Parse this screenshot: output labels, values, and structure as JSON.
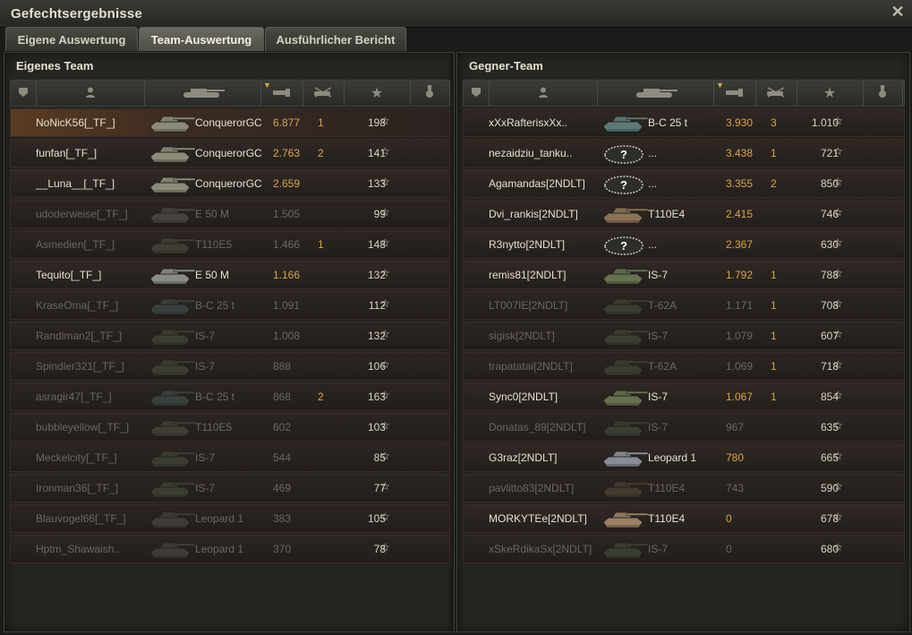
{
  "window": {
    "title": "Gefechtsergebnisse"
  },
  "tabs": [
    {
      "label": "Eigene Auswertung",
      "active": false
    },
    {
      "label": "Team-Auswertung",
      "active": true
    },
    {
      "label": "Ausführlicher Bericht",
      "active": false
    }
  ],
  "colors": {
    "damage": "#d7a64b",
    "accent_sort": "#d5a84a",
    "row_border": "#3a2a24"
  },
  "own_team": {
    "title": "Eigenes Team",
    "header_icons": [
      "platoon-icon",
      "player-icon",
      "tank-icon",
      "damage-icon",
      "kills-icon",
      "xp-star-icon",
      "medal-icon"
    ],
    "sorted_by": "damage-icon",
    "rows": [
      {
        "player": "NoNicK56[_TF_]",
        "tank": "ConquerorGC",
        "damage": "6.877",
        "kills": "1",
        "xp": "198",
        "alive": true,
        "top": true,
        "tank_color": "#8c8a78"
      },
      {
        "player": "funfan[_TF_]",
        "tank": "ConquerorGC",
        "damage": "2.763",
        "kills": "2",
        "xp": "141",
        "alive": true,
        "top": false,
        "tank_color": "#8c8a78"
      },
      {
        "player": "__Luna__[_TF_]",
        "tank": "ConquerorGC",
        "damage": "2.659",
        "kills": "",
        "xp": "133",
        "alive": true,
        "top": false,
        "tank_color": "#8c8a78"
      },
      {
        "player": "udoderweise[_TF_]",
        "tank": "E 50 M",
        "damage": "1.505",
        "kills": "",
        "xp": "99",
        "alive": false,
        "top": false,
        "tank_color": "#6b6e6a"
      },
      {
        "player": "Asmedien[_TF_]",
        "tank": "T110E5",
        "damage": "1.466",
        "kills": "1",
        "xp": "148",
        "alive": false,
        "top": false,
        "tank_color": "#5e6350"
      },
      {
        "player": "Tequito[_TF_]",
        "tank": "E 50 M",
        "damage": "1.166",
        "kills": "",
        "xp": "132",
        "alive": true,
        "top": false,
        "tank_color": "#8a8c86"
      },
      {
        "player": "KraseOma[_TF_]",
        "tank": "B-C 25 t",
        "damage": "1.091",
        "kills": "",
        "xp": "112",
        "alive": false,
        "top": false,
        "tank_color": "#4f6a68"
      },
      {
        "player": "Randlman2[_TF_]",
        "tank": "IS-7",
        "damage": "1.008",
        "kills": "",
        "xp": "132",
        "alive": false,
        "top": false,
        "tank_color": "#55624a"
      },
      {
        "player": "Spindler321[_TF_]",
        "tank": "IS-7",
        "damage": "888",
        "kills": "",
        "xp": "106",
        "alive": false,
        "top": false,
        "tank_color": "#55624a"
      },
      {
        "player": "asragir47[_TF_]",
        "tank": "B-C 25 t",
        "damage": "868",
        "kills": "2",
        "xp": "163",
        "alive": false,
        "top": false,
        "tank_color": "#4f6a68"
      },
      {
        "player": "bubbleyellow[_TF_]",
        "tank": "T110E5",
        "damage": "602",
        "kills": "",
        "xp": "103",
        "alive": false,
        "top": false,
        "tank_color": "#5e6350"
      },
      {
        "player": "Meckelcity[_TF_]",
        "tank": "IS-7",
        "damage": "544",
        "kills": "",
        "xp": "85",
        "alive": false,
        "top": false,
        "tank_color": "#55624a"
      },
      {
        "player": "Ironman36[_TF_]",
        "tank": "IS-7",
        "damage": "469",
        "kills": "",
        "xp": "77",
        "alive": false,
        "top": false,
        "tank_color": "#55624a"
      },
      {
        "player": "Blauvogel66[_TF_]",
        "tank": "Leopard 1",
        "damage": "383",
        "kills": "",
        "xp": "105",
        "alive": false,
        "top": false,
        "tank_color": "#5b5f58"
      },
      {
        "player": "Hptm_Shawaish..",
        "tank": "Leopard 1",
        "damage": "370",
        "kills": "",
        "xp": "78",
        "alive": false,
        "top": false,
        "tank_color": "#5b5f58"
      }
    ]
  },
  "enemy_team": {
    "title": "Gegner-Team",
    "header_icons": [
      "platoon-icon",
      "player-icon",
      "tank-icon",
      "damage-icon",
      "kills-icon",
      "xp-star-icon",
      "medal-icon"
    ],
    "sorted_by": "damage-icon",
    "rows": [
      {
        "player": "xXxRafterisxXx..",
        "tank": "B-C 25 t",
        "damage": "3.930",
        "kills": "3",
        "xp": "1.010",
        "alive": true,
        "top": false,
        "tank_color": "#5d7a76",
        "unknown": false
      },
      {
        "player": "nezaidziu_tanku..",
        "tank": "...",
        "damage": "3.438",
        "kills": "1",
        "xp": "721",
        "alive": true,
        "top": false,
        "tank_color": "#555",
        "unknown": true
      },
      {
        "player": "Agamandas[2NDLT]",
        "tank": "...",
        "damage": "3.355",
        "kills": "2",
        "xp": "850",
        "alive": true,
        "top": false,
        "tank_color": "#555",
        "unknown": true
      },
      {
        "player": "Dvi_rankis[2NDLT]",
        "tank": "T110E4",
        "damage": "2.415",
        "kills": "",
        "xp": "746",
        "alive": true,
        "top": false,
        "tank_color": "#8a7355",
        "unknown": false
      },
      {
        "player": "R3nytto[2NDLT]",
        "tank": "...",
        "damage": "2.367",
        "kills": "",
        "xp": "630",
        "alive": true,
        "top": false,
        "tank_color": "#555",
        "unknown": true
      },
      {
        "player": "remis81[2NDLT]",
        "tank": "IS-7",
        "damage": "1.792",
        "kills": "1",
        "xp": "788",
        "alive": true,
        "top": false,
        "tank_color": "#67704f",
        "unknown": false
      },
      {
        "player": "LT007IE[2NDLT]",
        "tank": "T-62A",
        "damage": "1.171",
        "kills": "1",
        "xp": "708",
        "alive": false,
        "top": false,
        "tank_color": "#56604a",
        "unknown": false
      },
      {
        "player": "sigisk[2NDLT]",
        "tank": "IS-7",
        "damage": "1.079",
        "kills": "1",
        "xp": "607",
        "alive": false,
        "top": false,
        "tank_color": "#55624a",
        "unknown": false
      },
      {
        "player": "trapatatai[2NDLT]",
        "tank": "T-62A",
        "damage": "1.069",
        "kills": "1",
        "xp": "718",
        "alive": false,
        "top": false,
        "tank_color": "#56604a",
        "unknown": false
      },
      {
        "player": "Sync0[2NDLT]",
        "tank": "IS-7",
        "damage": "1.067",
        "kills": "1",
        "xp": "854",
        "alive": true,
        "top": false,
        "tank_color": "#67704f",
        "unknown": false
      },
      {
        "player": "Donatas_89[2NDLT]",
        "tank": "IS-7",
        "damage": "967",
        "kills": "",
        "xp": "635",
        "alive": false,
        "top": false,
        "tank_color": "#55624a",
        "unknown": false
      },
      {
        "player": "G3raz[2NDLT]",
        "tank": "Leopard 1",
        "damage": "780",
        "kills": "",
        "xp": "665",
        "alive": true,
        "top": false,
        "tank_color": "#8a8d95",
        "unknown": false
      },
      {
        "player": "pavlitto83[2NDLT]",
        "tank": "T110E4",
        "damage": "743",
        "kills": "",
        "xp": "590",
        "alive": false,
        "top": false,
        "tank_color": "#6a5a45",
        "unknown": false
      },
      {
        "player": "MORKYTEe[2NDLT]",
        "tank": "T110E4",
        "damage": "0",
        "kills": "",
        "xp": "678",
        "alive": true,
        "top": false,
        "tank_color": "#9a8060",
        "unknown": false
      },
      {
        "player": "xSkeRdikaSx[2NDLT]",
        "tank": "IS-7",
        "damage": "0",
        "kills": "",
        "xp": "680",
        "alive": false,
        "top": false,
        "tank_color": "#55624a",
        "unknown": false
      }
    ]
  }
}
